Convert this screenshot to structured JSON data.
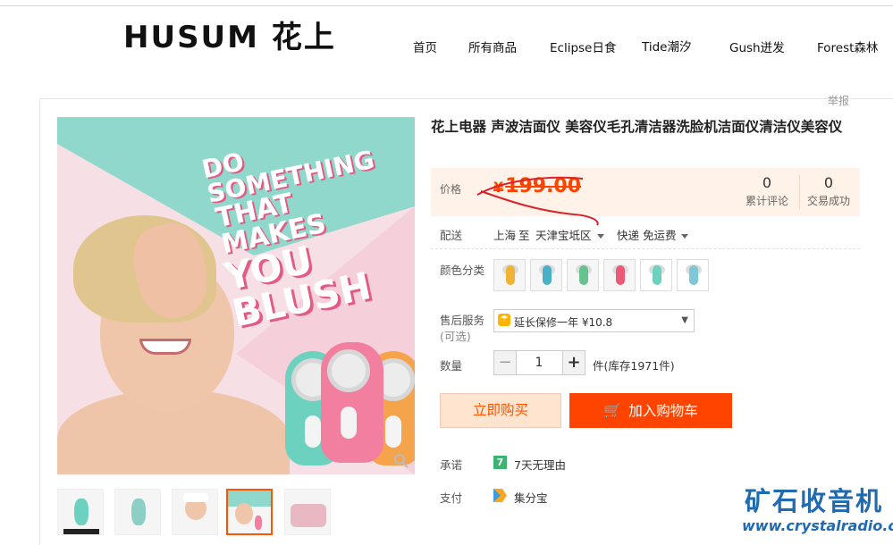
{
  "header": {
    "logo": "HUSUM 花上",
    "nav": [
      "首页",
      "所有商品",
      "Eclipse日食",
      "Tide潮汐",
      "Gush迸发",
      "Forest森林"
    ]
  },
  "report": "举报",
  "hero": {
    "slogan": [
      "DO SOMETHING",
      "THAT MAKES",
      "YOU BLUSH"
    ],
    "colors": {
      "teal": "#8fd8cb",
      "pink": "#f27ea0",
      "orange": "#f6a44c"
    }
  },
  "thumbnails": {
    "count": 5,
    "active_index": 3
  },
  "product": {
    "title": "花上电器 声波洁面仪 美容仪毛孔清洁器洗脸机洁面仪清洁仪美容仪",
    "price_label": "价格",
    "currency": "¥",
    "price": "199.00",
    "reviews": {
      "count": "0",
      "label": "累计评论"
    },
    "deals": {
      "count": "0",
      "label": "交易成功"
    },
    "shipping": {
      "label": "配送",
      "from": "上海",
      "to_word": "至",
      "destination": "天津宝坻区",
      "method": "快递 免运费"
    },
    "color": {
      "label": "颜色分类",
      "options": [
        "#f2b233",
        "#4ab0c8",
        "#66c28f",
        "#e95a75",
        "#6cd1be",
        "#7fc6d6"
      ]
    },
    "service": {
      "label": "售后服务",
      "optional": "(可选)",
      "selected": "延长保修一年 ¥10.8"
    },
    "quantity": {
      "label": "数量",
      "value": "1",
      "unit": "件(库存1971件)"
    },
    "buy_now": "立即购买",
    "add_to_cart": "加入购物车",
    "promise": {
      "label": "承诺",
      "icon_text": "7",
      "text": "7天无理由"
    },
    "payment": {
      "label": "支付",
      "text": "集分宝"
    }
  },
  "watermark": {
    "title": "矿石收音机",
    "url": "www.crystalradio.cn"
  }
}
